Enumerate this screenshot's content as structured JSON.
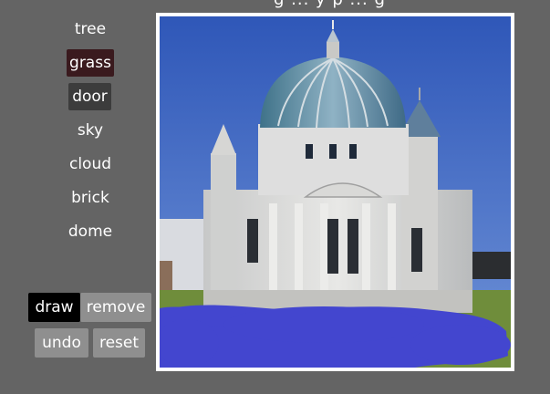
{
  "header": {
    "text": "g ... y p ... g"
  },
  "labels": {
    "items": [
      {
        "label": "tree"
      },
      {
        "label": "grass",
        "selected": true,
        "color": "#3a1a1e"
      },
      {
        "label": "door",
        "hover": true,
        "color": "#3c3c3c"
      },
      {
        "label": "sky"
      },
      {
        "label": "cloud"
      },
      {
        "label": "brick"
      },
      {
        "label": "dome"
      }
    ]
  },
  "tools": {
    "draw_label": "draw",
    "remove_label": "remove",
    "undo_label": "undo",
    "reset_label": "reset",
    "active": "draw"
  },
  "canvas": {
    "image": "generated-building-image",
    "stroke_color": "#4346cf",
    "frame_color": "#ffffff"
  },
  "colors": {
    "background": "#646464",
    "button_gray": "#8f8f8f",
    "button_active": "#000000"
  }
}
